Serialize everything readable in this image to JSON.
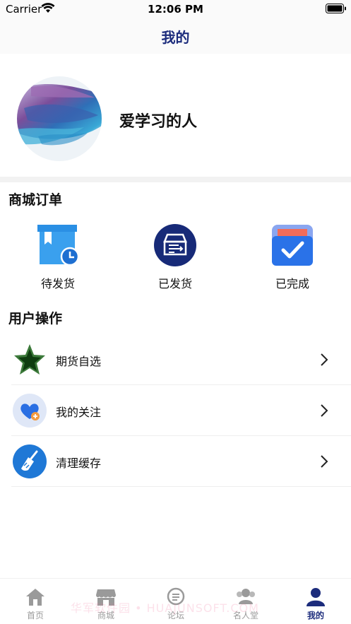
{
  "status_bar": {
    "carrier": "Carrier",
    "time": "12:06 PM"
  },
  "nav": {
    "title": "我的"
  },
  "profile": {
    "username": "爱学习的人"
  },
  "orders": {
    "title": "商城订单",
    "items": [
      {
        "label": "待发货",
        "icon": "package-clock-icon"
      },
      {
        "label": "已发货",
        "icon": "shipping-box-icon"
      },
      {
        "label": "已完成",
        "icon": "completed-check-icon"
      }
    ]
  },
  "operations": {
    "title": "用户操作",
    "items": [
      {
        "label": "期货自选",
        "icon": "star-icon"
      },
      {
        "label": "我的关注",
        "icon": "heart-plus-icon"
      },
      {
        "label": "清理缓存",
        "icon": "broom-icon"
      }
    ]
  },
  "tabs": [
    {
      "label": "首页",
      "icon": "home-icon"
    },
    {
      "label": "商城",
      "icon": "store-icon"
    },
    {
      "label": "论坛",
      "icon": "forum-icon"
    },
    {
      "label": "名人堂",
      "icon": "people-icon"
    },
    {
      "label": "我的",
      "icon": "user-icon",
      "active": true
    }
  ],
  "watermark": "华军软件园 • HUAJUNSOFT.COM",
  "colors": {
    "accent": "#1c2c7c",
    "inactive_tab": "#9a9a9a",
    "blue_icon": "#2a7fe0"
  }
}
